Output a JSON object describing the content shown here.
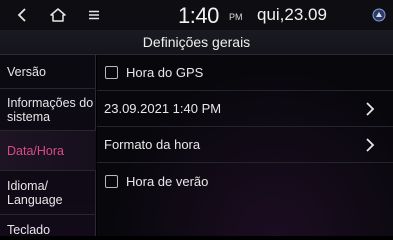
{
  "statusbar": {
    "back_icon": "chevron-left-icon",
    "home_icon": "home-icon",
    "menu_icon": "menu-icon",
    "time": "1:40",
    "ampm": "PM",
    "date": "qui,23.09",
    "status_icon": "signal-icon"
  },
  "header": {
    "title": "Definições gerais"
  },
  "sidebar": {
    "items": [
      {
        "label": "Versão"
      },
      {
        "label": "Informações do sistema"
      },
      {
        "label": "Data/Hora",
        "active": true
      },
      {
        "label": "Idioma/ Language"
      },
      {
        "label": "Teclado"
      }
    ]
  },
  "settings": {
    "gps_time": {
      "label": "Hora do GPS",
      "checked": false
    },
    "datetime": {
      "label": "23.09.2021 1:40  PM"
    },
    "time_format": {
      "label": "Formato da hora"
    },
    "dst": {
      "label": "Hora de verão",
      "checked": false
    }
  },
  "colors": {
    "accent": "#d84a8a",
    "background": "#000000"
  }
}
